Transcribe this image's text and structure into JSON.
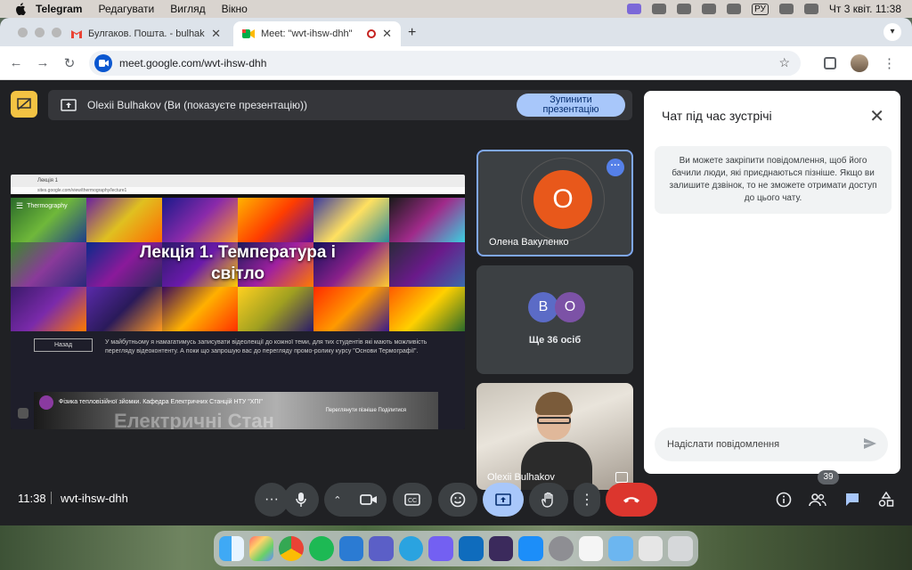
{
  "menubar": {
    "app": "Telegram",
    "items": [
      "Редагувати",
      "Вигляд",
      "Вікно"
    ],
    "keyboard": "РУ",
    "datetime": "Чт 3 квіт.  11:38"
  },
  "browser": {
    "tabs": [
      {
        "title": "Булгаков. Пошта. - bulhakov",
        "icon": "gmail-icon"
      },
      {
        "title": "Meet: \"wvt-ihsw-dhh\"",
        "icon": "meet-icon"
      }
    ],
    "url": "meet.google.com/wvt-ihsw-dhh"
  },
  "presenting": {
    "text": "Olexii Bulhakov (Ви (показуєте презентацію))",
    "stop_label": "Зупинити презентацію"
  },
  "shared_screen": {
    "tab_title": "Лекція 1",
    "url": "sites.google.com/view/thermography/lecture1",
    "logo_text": "Thermography",
    "title_line1": "Лекція 1. Температура і",
    "title_line2": "світло",
    "back_label": "Назад",
    "paragraph": "У майбутньому я намагатимусь записувати відеолекції до кожної теми, для тих студентів які мають можливість перегляду відеоконтенту. А поки що запрошую вас до перегляду промо-ролику курсу \"Основи Термографії\".",
    "video_title": "Фізика тепловізійної зйомки. Кафедра Електричних Станцій НТУ \"ХПІ\"",
    "video_watermark": "Електричні Стан",
    "video_actions": "Переглянути пізніше  Поділитися"
  },
  "tiles": {
    "tile1": {
      "initial": "О",
      "name": "Олена Вакуленко",
      "color": "#e8581b"
    },
    "tile2": {
      "initials": [
        "В",
        "О"
      ],
      "colors": [
        "#5b6bc6",
        "#7c52a6"
      ],
      "label": "Ще 36 осіб"
    },
    "tile3": {
      "name": "Olexii Bulhakov"
    }
  },
  "chat": {
    "title": "Чат під час зустрічі",
    "note": "Ви можете закріпити повідомлення, щоб його бачили люди, які приєднаються пізніше. Якщо ви залишите дзвінок, то не зможете отримати доступ до цього чату.",
    "input_placeholder": "Надіслати повідомлення"
  },
  "bottom": {
    "time": "11:38",
    "meeting_code": "wvt-ihsw-dhh",
    "participants_count": "39"
  },
  "colors": {
    "accent": "#a8c7fa",
    "end_call": "#dc362e",
    "presenting_badge": "#f3c343"
  }
}
